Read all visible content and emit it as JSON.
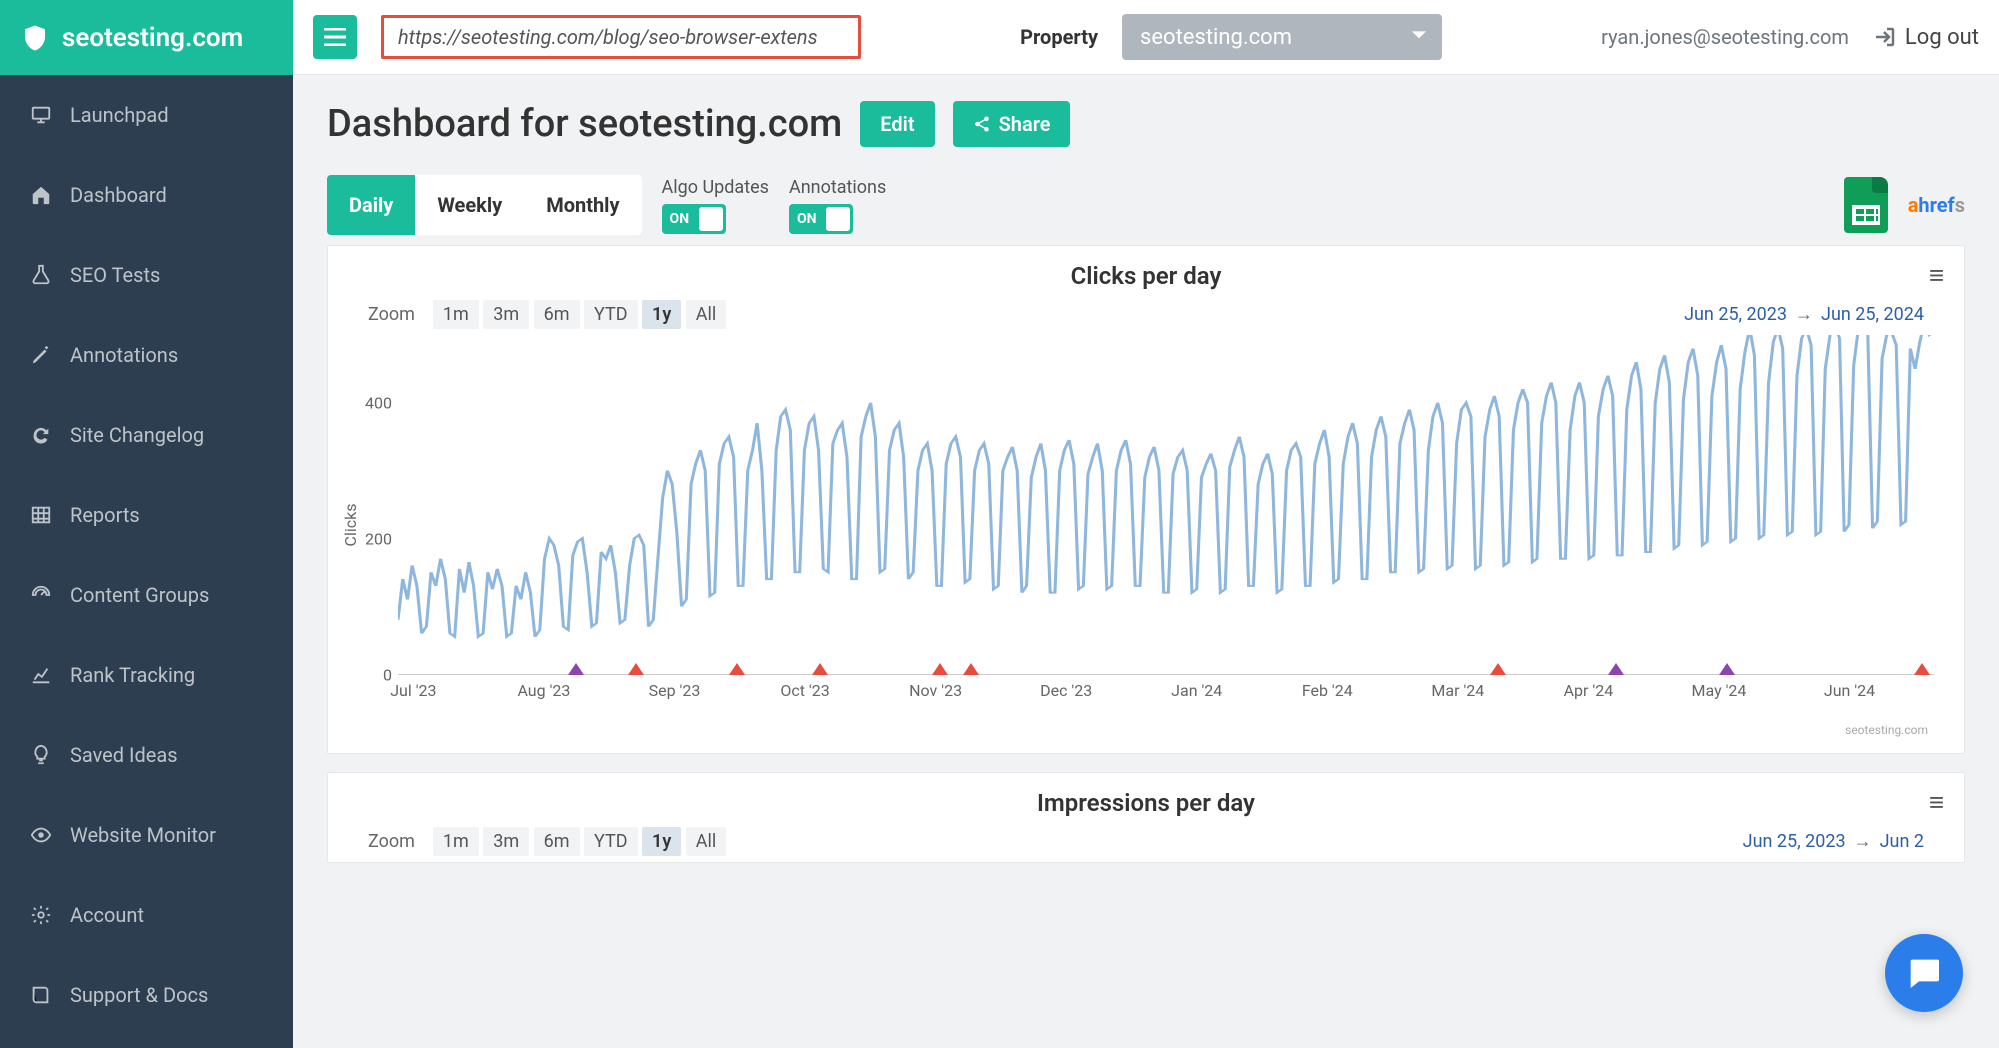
{
  "brand": "seotesting.com",
  "url_input": "https://seotesting.com/blog/seo-browser-extens",
  "property_label": "Property",
  "property_value": "seotesting.com",
  "user_email": "ryan.jones@seotesting.com",
  "logout": "Log out",
  "sidebar": [
    {
      "label": "Launchpad",
      "icon": "monitor"
    },
    {
      "label": "Dashboard",
      "icon": "home"
    },
    {
      "label": "SEO Tests",
      "icon": "flask"
    },
    {
      "label": "Annotations",
      "icon": "pencil"
    },
    {
      "label": "Site Changelog",
      "icon": "refresh"
    },
    {
      "label": "Reports",
      "icon": "table"
    },
    {
      "label": "Content Groups",
      "icon": "gauge"
    },
    {
      "label": "Rank Tracking",
      "icon": "chart"
    },
    {
      "label": "Saved Ideas",
      "icon": "bulb"
    },
    {
      "label": "Website Monitor",
      "icon": "eye"
    },
    {
      "label": "Account",
      "icon": "gear"
    },
    {
      "label": "Support & Docs",
      "icon": "book"
    }
  ],
  "page_title": "Dashboard for seotesting.com",
  "edit_label": "Edit",
  "share_label": "Share",
  "period_tabs": [
    "Daily",
    "Weekly",
    "Monthly"
  ],
  "period_active": "Daily",
  "toggles": {
    "algo": {
      "label": "Algo Updates",
      "state": "ON"
    },
    "anno": {
      "label": "Annotations",
      "state": "ON"
    }
  },
  "integrations": {
    "sheets": "Google Sheets",
    "ahrefs": "ahrefs"
  },
  "zoom": {
    "label": "Zoom",
    "options": [
      "1m",
      "3m",
      "6m",
      "YTD",
      "1y",
      "All"
    ],
    "active": "1y"
  },
  "chart_credit": "seotesting.com",
  "charts": [
    {
      "key": "clicks",
      "title": "Clicks per day",
      "ylabel": "Clicks",
      "date_from": "Jun 25, 2023",
      "date_to": "Jun 25, 2024"
    },
    {
      "key": "impressions",
      "title": "Impressions per day",
      "ylabel": "",
      "date_from": "Jun 25, 2023",
      "date_to": "Jun 2"
    }
  ],
  "chart_data": {
    "type": "line",
    "title": "Clicks per day",
    "ylabel": "Clicks",
    "ylim": [
      0,
      500
    ],
    "yticks": [
      0,
      200,
      400
    ],
    "x_tick_labels": [
      "Jul '23",
      "Aug '23",
      "Sep '23",
      "Oct '23",
      "Nov '23",
      "Dec '23",
      "Jan '24",
      "Feb '24",
      "Mar '24",
      "Apr '24",
      "May '24",
      "Jun '24"
    ],
    "x_tick_positions": [
      0.01,
      0.095,
      0.18,
      0.265,
      0.35,
      0.435,
      0.52,
      0.605,
      0.69,
      0.775,
      0.86,
      0.945
    ],
    "markers": [
      {
        "pos": 0.116,
        "kind": "purple"
      },
      {
        "pos": 0.155,
        "kind": "red"
      },
      {
        "pos": 0.221,
        "kind": "red"
      },
      {
        "pos": 0.275,
        "kind": "red"
      },
      {
        "pos": 0.353,
        "kind": "red"
      },
      {
        "pos": 0.373,
        "kind": "red"
      },
      {
        "pos": 0.716,
        "kind": "red"
      },
      {
        "pos": 0.793,
        "kind": "purple"
      },
      {
        "pos": 0.865,
        "kind": "purple"
      },
      {
        "pos": 0.992,
        "kind": "red"
      }
    ],
    "series": [
      {
        "name": "Clicks",
        "color": "#8fb6dd",
        "values": [
          80,
          140,
          110,
          160,
          130,
          60,
          70,
          150,
          130,
          170,
          140,
          60,
          55,
          155,
          120,
          165,
          130,
          55,
          60,
          150,
          125,
          155,
          130,
          55,
          60,
          130,
          110,
          150,
          120,
          55,
          65,
          170,
          200,
          190,
          160,
          70,
          65,
          175,
          195,
          200,
          150,
          70,
          75,
          180,
          170,
          190,
          150,
          75,
          80,
          160,
          200,
          205,
          190,
          70,
          80,
          170,
          260,
          300,
          280,
          210,
          100,
          110,
          280,
          310,
          330,
          300,
          115,
          120,
          310,
          340,
          350,
          320,
          130,
          130,
          300,
          330,
          370,
          300,
          140,
          140,
          330,
          380,
          390,
          360,
          150,
          150,
          330,
          370,
          380,
          330,
          155,
          150,
          340,
          360,
          370,
          320,
          140,
          140,
          350,
          380,
          400,
          350,
          150,
          155,
          330,
          360,
          370,
          320,
          140,
          150,
          300,
          330,
          340,
          300,
          130,
          130,
          310,
          340,
          350,
          320,
          135,
          140,
          300,
          330,
          340,
          310,
          125,
          130,
          300,
          320,
          335,
          300,
          120,
          130,
          290,
          320,
          340,
          300,
          120,
          120,
          300,
          330,
          345,
          310,
          125,
          130,
          295,
          320,
          340,
          300,
          125,
          130,
          300,
          330,
          345,
          310,
          130,
          130,
          290,
          320,
          335,
          300,
          120,
          120,
          295,
          320,
          330,
          300,
          120,
          125,
          290,
          310,
          325,
          300,
          120,
          125,
          305,
          330,
          350,
          320,
          130,
          130,
          280,
          310,
          325,
          295,
          120,
          125,
          300,
          330,
          340,
          320,
          130,
          130,
          310,
          340,
          360,
          320,
          135,
          140,
          310,
          350,
          370,
          340,
          140,
          140,
          320,
          360,
          380,
          350,
          150,
          150,
          340,
          370,
          390,
          360,
          150,
          155,
          330,
          380,
          400,
          370,
          155,
          160,
          340,
          390,
          400,
          380,
          155,
          160,
          350,
          390,
          410,
          380,
          160,
          165,
          360,
          400,
          420,
          400,
          165,
          170,
          370,
          410,
          430,
          400,
          170,
          170,
          360,
          410,
          430,
          400,
          170,
          175,
          380,
          420,
          440,
          410,
          175,
          175,
          390,
          440,
          460,
          420,
          180,
          180,
          400,
          450,
          470,
          430,
          185,
          190,
          405,
          460,
          480,
          440,
          190,
          195,
          410,
          460,
          485,
          450,
          195,
          200,
          420,
          475,
          510,
          470,
          200,
          205,
          430,
          490,
          510,
          480,
          205,
          210,
          440,
          495,
          510,
          485,
          205,
          210,
          450,
          500,
          515,
          495,
          210,
          220,
          455,
          510,
          520,
          500,
          215,
          225,
          465,
          500,
          505,
          485,
          220,
          225,
          480,
          450,
          490,
          520,
          500,
          505
        ]
      }
    ]
  }
}
